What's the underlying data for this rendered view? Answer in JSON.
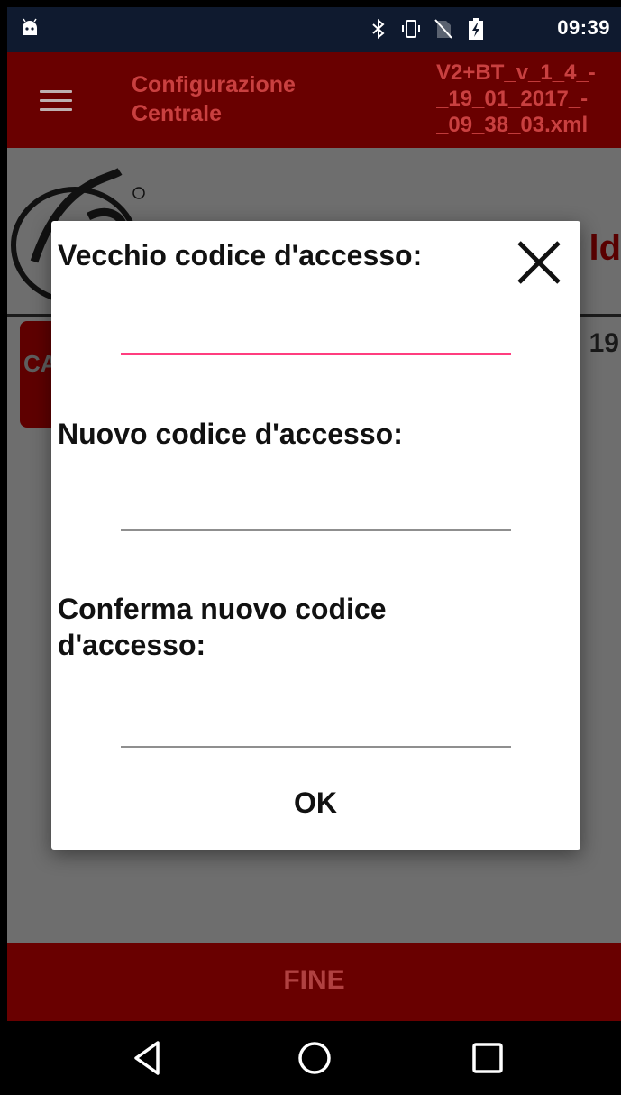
{
  "status_bar": {
    "time": "09:39",
    "icons": [
      "android-icon",
      "bluetooth-icon",
      "vibrate-icon",
      "no-sim-icon",
      "battery-charging-icon"
    ]
  },
  "app_bar": {
    "title": "Configurazione\nCentrale",
    "file_name": "V2+BT_v_1_4_-\n_19_01_2017_-\n_09_38_03.xml"
  },
  "background": {
    "partial_title": "ld",
    "partial_button": "CA",
    "partial_number": "19"
  },
  "dialog": {
    "old_code_label": "Vecchio codice d'accesso:",
    "old_code_value": "",
    "new_code_label": "Nuovo codice d'accesso:",
    "new_code_value": "",
    "confirm_code_label": "Conferma nuovo codice\nd'accesso:",
    "confirm_code_value": "",
    "ok_label": "OK"
  },
  "bottom_bar": {
    "fine_label": "FINE"
  },
  "colors": {
    "app_bar": "#690000",
    "title_text": "#c94040",
    "focus_underline": "#ff3d7f",
    "status_bar": "#0f1a2f"
  }
}
